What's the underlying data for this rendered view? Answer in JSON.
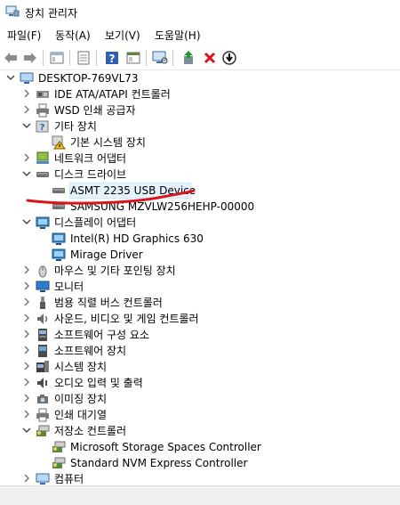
{
  "window": {
    "title": "장치 관리자",
    "icon": "device-manager-icon"
  },
  "menu": [
    "파일(F)",
    "동작(A)",
    "보기(V)",
    "도움말(H)"
  ],
  "toolbar": {
    "buttons": [
      "back-arrow-icon",
      "forward-arrow-icon",
      "properties-icon",
      "update-driver-icon",
      "help-icon",
      "show-hidden-icon",
      "scan-hardware-icon",
      "enable-device-icon",
      "uninstall-icon",
      "disable-device-icon"
    ]
  },
  "tree": {
    "root": "DESKTOP-769VL73",
    "items": [
      {
        "label": "IDE ATA/ATAPI 컨트롤러",
        "expanded": false,
        "icon": "ide-controller-icon"
      },
      {
        "label": "WSD 인쇄 공급자",
        "expanded": false,
        "icon": "printer-icon"
      },
      {
        "label": "기타 장치",
        "expanded": true,
        "icon": "unknown-device-icon",
        "children": [
          {
            "label": "기본 시스템 장치",
            "icon": "warning-device-icon"
          }
        ]
      },
      {
        "label": "네트워크 어댑터",
        "expanded": false,
        "icon": "network-adapter-icon"
      },
      {
        "label": "디스크 드라이브",
        "expanded": true,
        "icon": "disk-drive-icon",
        "children": [
          {
            "label": "ASMT 2235 USB Device",
            "icon": "disk-drive-icon",
            "selected": true
          },
          {
            "label": "SAMSUNG MZVLW256HEHP-00000",
            "icon": "disk-drive-icon"
          }
        ]
      },
      {
        "label": "디스플레이 어댑터",
        "expanded": true,
        "icon": "display-adapter-icon",
        "children": [
          {
            "label": "Intel(R) HD Graphics 630",
            "icon": "display-adapter-icon"
          },
          {
            "label": "Mirage Driver",
            "icon": "display-adapter-icon"
          }
        ]
      },
      {
        "label": "마우스 및 기타 포인팅 장치",
        "expanded": false,
        "icon": "mouse-icon"
      },
      {
        "label": "모니터",
        "expanded": false,
        "icon": "monitor-icon"
      },
      {
        "label": "범용 직렬 버스 컨트롤러",
        "expanded": false,
        "icon": "usb-icon"
      },
      {
        "label": "사운드, 비디오 및 게임 컨트롤러",
        "expanded": false,
        "icon": "speaker-icon"
      },
      {
        "label": "소프트웨어 구성 요소",
        "expanded": false,
        "icon": "software-component-icon"
      },
      {
        "label": "소프트웨어 장치",
        "expanded": false,
        "icon": "software-device-icon"
      },
      {
        "label": "시스템 장치",
        "expanded": false,
        "icon": "system-device-icon"
      },
      {
        "label": "오디오 입력 및 출력",
        "expanded": false,
        "icon": "audio-icon"
      },
      {
        "label": "이미징 장치",
        "expanded": false,
        "icon": "camera-icon"
      },
      {
        "label": "인쇄 대기열",
        "expanded": false,
        "icon": "printer-icon"
      },
      {
        "label": "저장소 컨트롤러",
        "expanded": true,
        "icon": "storage-controller-icon",
        "children": [
          {
            "label": "Microsoft Storage Spaces Controller",
            "icon": "storage-controller-icon"
          },
          {
            "label": "Standard NVM Express Controller",
            "icon": "storage-controller-icon"
          }
        ]
      },
      {
        "label": "컴퓨터",
        "expanded": false,
        "icon": "computer-icon"
      }
    ]
  },
  "annotation": {
    "type": "red-underline",
    "color": "#d9151b"
  },
  "colors": {
    "selection": "#e5f3ff",
    "selection_border": "#cce8ff",
    "annotation": "#d9151b"
  }
}
